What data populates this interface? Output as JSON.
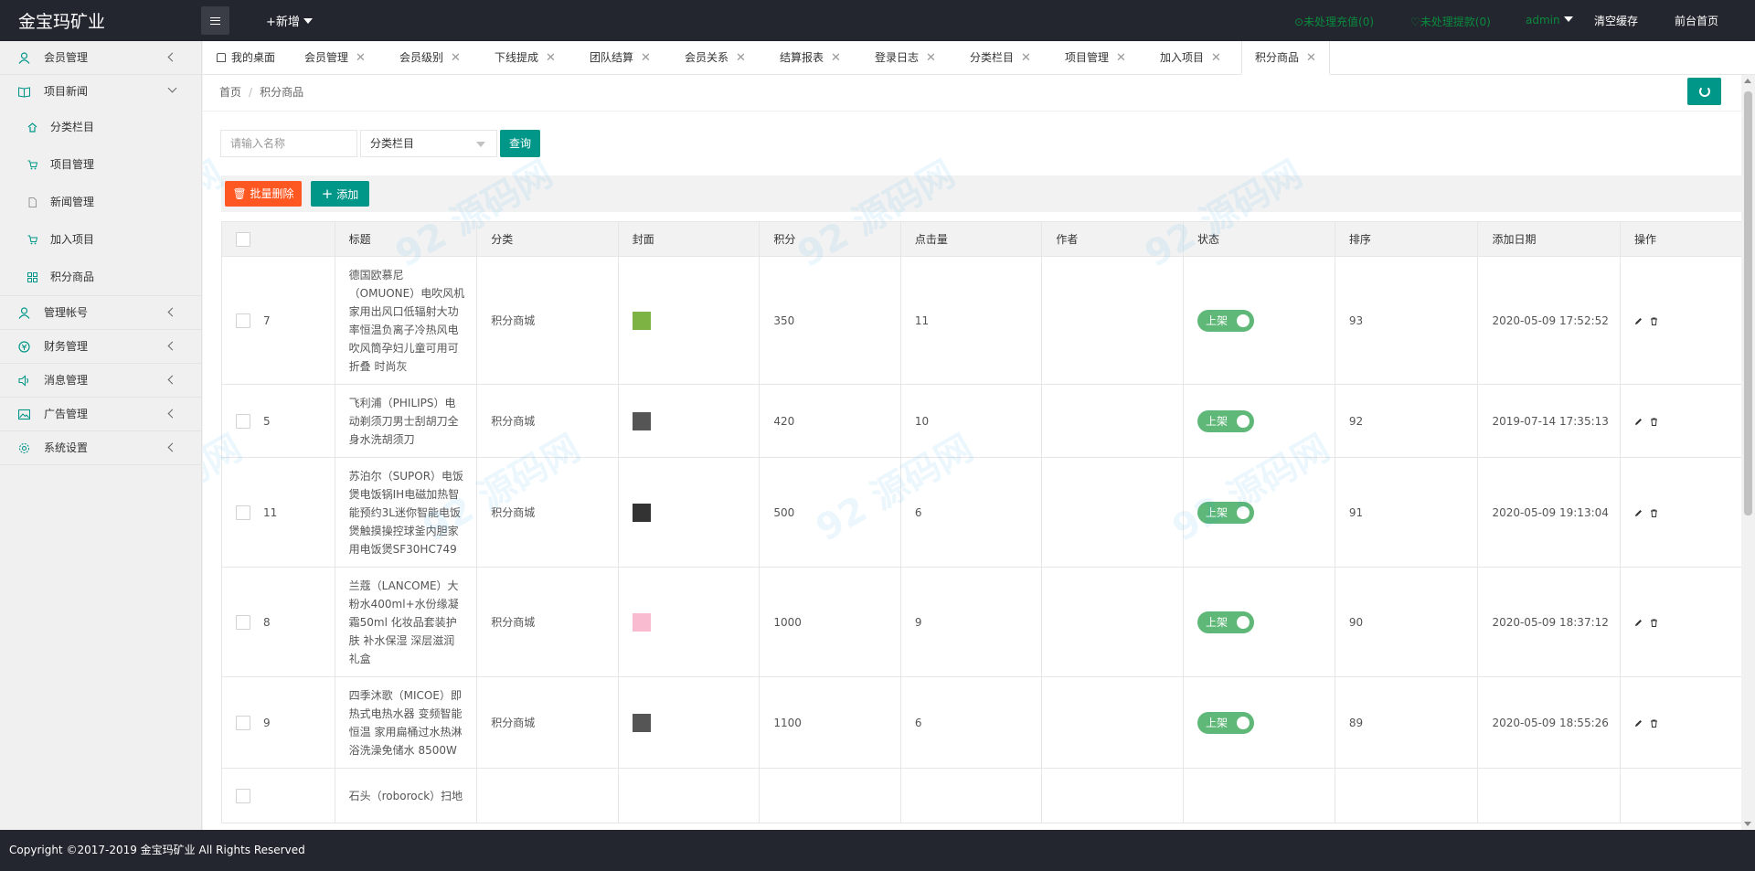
{
  "app": {
    "logo": "金宝玛矿业",
    "add_new": "+新增"
  },
  "header": {
    "recharge": "⊙未处理充值(0)",
    "withdraw": "♡未处理提款(0)",
    "user": "admin",
    "clear_cache": "清空缓存",
    "front_home": "前台首页"
  },
  "sidebar": {
    "items": [
      {
        "label": "会员管理",
        "icon": "user-icon"
      },
      {
        "label": "项目新闻",
        "icon": "book-icon",
        "open": true,
        "children": [
          {
            "label": "分类栏目",
            "icon": "tag-icon"
          },
          {
            "label": "项目管理",
            "icon": "cart-icon"
          },
          {
            "label": "新闻管理",
            "icon": "doc-icon"
          },
          {
            "label": "加入项目",
            "icon": "cart-icon"
          },
          {
            "label": "积分商品",
            "icon": "grid-icon"
          }
        ]
      },
      {
        "label": "管理帐号",
        "icon": "user-icon"
      },
      {
        "label": "财务管理",
        "icon": "finance-icon"
      },
      {
        "label": "消息管理",
        "icon": "sound-icon"
      },
      {
        "label": "广告管理",
        "icon": "image-icon"
      },
      {
        "label": "系统设置",
        "icon": "gear-icon"
      }
    ]
  },
  "tabs": [
    {
      "label": "我的桌面"
    },
    {
      "label": "会员管理"
    },
    {
      "label": "会员级别"
    },
    {
      "label": "下线提成"
    },
    {
      "label": "团队结算"
    },
    {
      "label": "会员关系"
    },
    {
      "label": "结算报表"
    },
    {
      "label": "登录日志"
    },
    {
      "label": "分类栏目"
    },
    {
      "label": "项目管理"
    },
    {
      "label": "加入项目"
    },
    {
      "label": "积分商品"
    }
  ],
  "breadcrumb": {
    "home": "首页",
    "sep": "/",
    "current": "积分商品"
  },
  "search": {
    "placeholder": "请输入名称",
    "category_select": "分类栏目",
    "query_button": "查询"
  },
  "toolbar": {
    "batch_delete": "批量删除",
    "add": "添加"
  },
  "table": {
    "headers": [
      "标题",
      "分类",
      "封面",
      "积分",
      "点击量",
      "作者",
      "状态",
      "排序",
      "添加日期",
      "操作"
    ],
    "rows": [
      {
        "id": "7",
        "title": "德国欧慕尼（OMUONE）电吹风机家用出风口低辐射大功率恒温负离子冷热风电吹风筒孕妇儿童可用可折叠 时尚灰",
        "category": "积分商城",
        "points": "350",
        "clicks": "11",
        "author": "",
        "status": "上架",
        "sort": "93",
        "date": "2020-05-09 17:52:52",
        "thumb_color": "#7cb342"
      },
      {
        "id": "5",
        "title": "飞利浦（PHILIPS）电动剃须刀男士刮胡刀全身水洗胡须刀",
        "category": "积分商城",
        "points": "420",
        "clicks": "10",
        "author": "",
        "status": "上架",
        "sort": "92",
        "date": "2019-07-14 17:35:13",
        "thumb_color": "#555555"
      },
      {
        "id": "11",
        "title": "苏泊尔（SUPOR）电饭煲电饭锅IH电磁加热智能预约3L迷你智能电饭煲触摸操控球釜内胆家用电饭煲SF30HC749",
        "category": "积分商城",
        "points": "500",
        "clicks": "6",
        "author": "",
        "status": "上架",
        "sort": "91",
        "date": "2020-05-09 19:13:04",
        "thumb_color": "#333333"
      },
      {
        "id": "8",
        "title": "兰蔻（LANCOME）大粉水400ml+水份缘凝霜50ml 化妆品套装护肤 补水保湿 深层滋润礼盒",
        "category": "积分商城",
        "points": "1000",
        "clicks": "9",
        "author": "",
        "status": "上架",
        "sort": "90",
        "date": "2020-05-09 18:37:12",
        "thumb_color": "#f8bbd0"
      },
      {
        "id": "9",
        "title": "四季沐歌（MICOE）即热式电热水器 变频智能恒温 家用扁桶过水热淋浴洗澡免储水 8500W",
        "category": "积分商城",
        "points": "1100",
        "clicks": "6",
        "author": "",
        "status": "上架",
        "sort": "89",
        "date": "2020-05-09 18:55:26",
        "thumb_color": "#555555"
      },
      {
        "id": "",
        "title": "石头（roborock）扫地",
        "category": "",
        "points": "",
        "clicks": "",
        "author": "",
        "status": "",
        "sort": "",
        "date": "",
        "thumb_color": ""
      }
    ]
  },
  "footer": {
    "copyright": "Copyright ©2017-2019 金宝玛矿业 All Rights Reserved"
  },
  "colors": {
    "header_bg": "#23262e",
    "primary": "#009688",
    "danger": "#ff5722",
    "switch_on": "#5fb878",
    "header_link": "#0a8a3e"
  }
}
